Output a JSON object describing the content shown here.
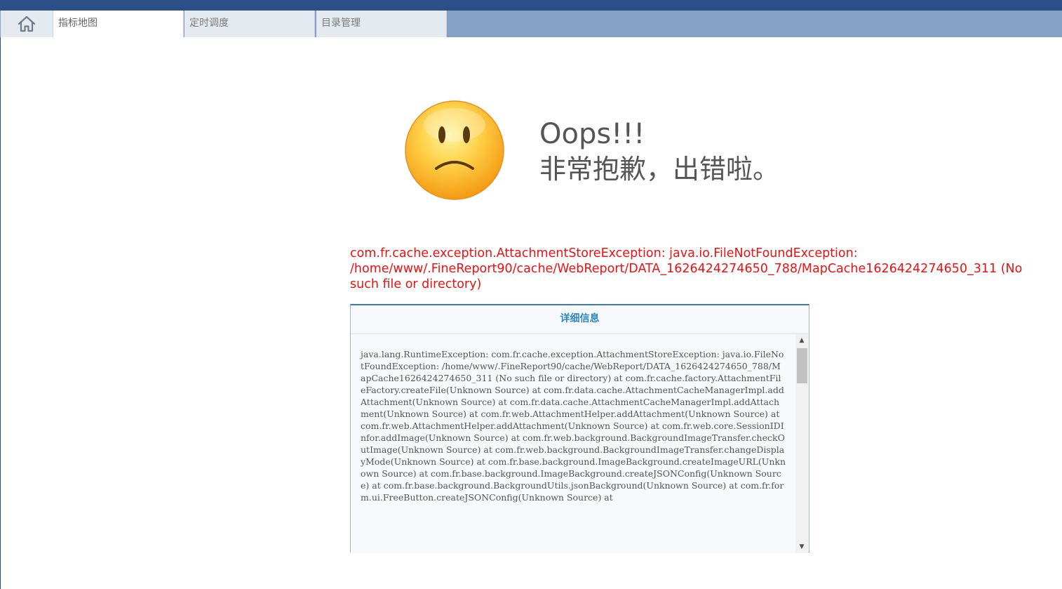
{
  "tabs": [
    {
      "label": "指标地图",
      "active": true
    },
    {
      "label": "定时调度",
      "active": false
    },
    {
      "label": "目录管理",
      "active": false
    }
  ],
  "error": {
    "face_icon": "sad-face-icon",
    "title_line1": "Oops!!!",
    "title_line2": "非常抱歉，出错啦。",
    "message": "com.fr.cache.exception.AttachmentStoreException: java.io.FileNotFoundException: /home/www/.FineReport90/cache/WebReport/DATA_1626424274650_788/MapCache1626424274650_311 (No such file or directory)"
  },
  "details": {
    "title": "详细信息",
    "stack_trace": "java.lang.RuntimeException: com.fr.cache.exception.AttachmentStoreException: java.io.FileNotFoundException: /home/www/.FineReport90/cache/WebReport/DATA_1626424274650_788/MapCache1626424274650_311 (No such file or directory) at com.fr.cache.factory.AttachmentFileFactory.createFile(Unknown Source) at com.fr.data.cache.AttachmentCacheManagerImpl.addAttachment(Unknown Source) at com.fr.data.cache.AttachmentCacheManagerImpl.addAttachment(Unknown Source) at com.fr.web.AttachmentHelper.addAttachment(Unknown Source) at com.fr.web.AttachmentHelper.addAttachment(Unknown Source) at com.fr.web.core.SessionIDInfor.addImage(Unknown Source) at com.fr.web.background.BackgroundImageTransfer.checkOutImage(Unknown Source) at com.fr.web.background.BackgroundImageTransfer.changeDisplayMode(Unknown Source) at com.fr.base.background.ImageBackground.createImageURL(Unknown Source) at com.fr.base.background.ImageBackground.createJSONConfig(Unknown Source) at com.fr.base.background.BackgroundUtils.jsonBackground(Unknown Source) at com.fr.form.ui.FreeButton.createJSONConfig(Unknown Source) at"
  },
  "colors": {
    "header": "#2b4f87",
    "tabbar": "#87a0c6",
    "error_text": "#ee1111",
    "detail_title": "#2d86c8"
  }
}
